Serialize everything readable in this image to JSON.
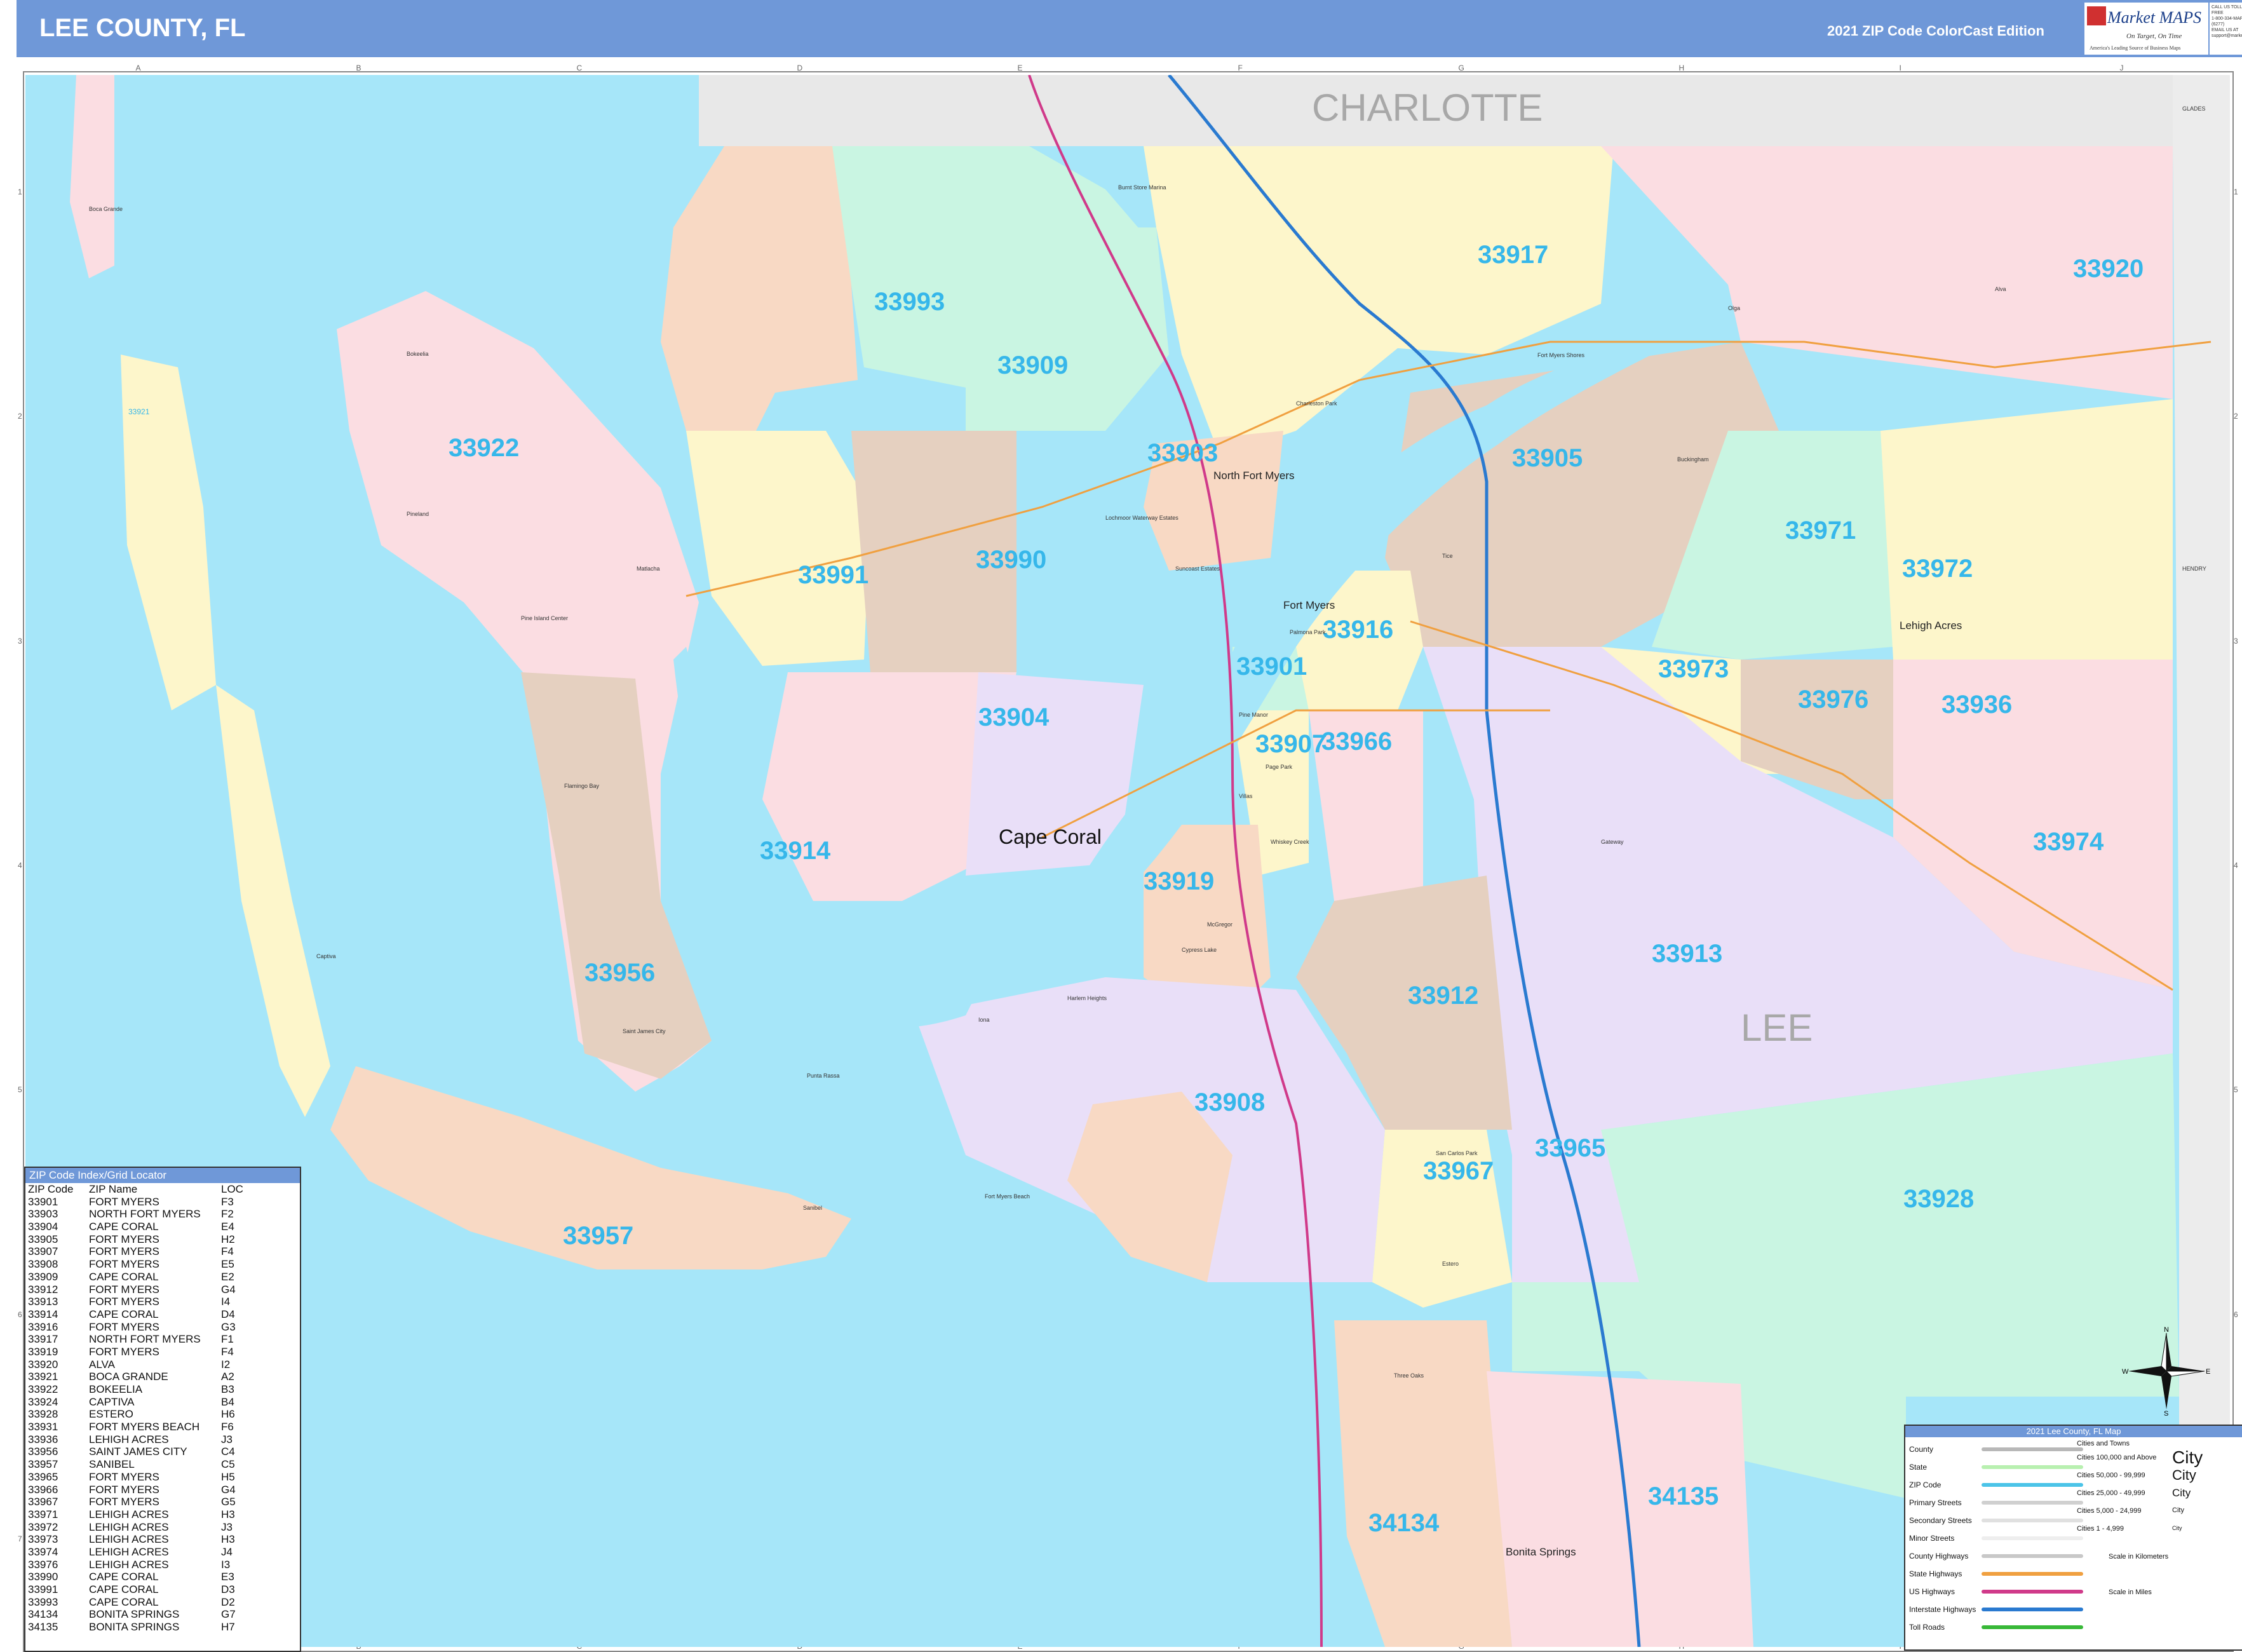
{
  "header": {
    "title": "LEE COUNTY, FL",
    "edition": "2021 ZIP Code ColorCast Edition",
    "logo_text": "Market MAPS",
    "logo_tagline": "On Target, On Time",
    "logo_subtitle": "America's Leading Source of Business Maps",
    "contact_lines": [
      "CALL US TOLL FREE",
      "1-800-334-MAPS (6277)",
      "EMAIL US AT",
      "support@marketmaps.com"
    ]
  },
  "grid": {
    "columns": [
      "A",
      "B",
      "C",
      "D",
      "E",
      "F",
      "G",
      "H",
      "I",
      "J"
    ],
    "rows": [
      "1",
      "2",
      "3",
      "4",
      "5",
      "6",
      "7"
    ]
  },
  "map": {
    "county_labels": [
      "CHARLOTTE",
      "LEE"
    ],
    "neighbor_labels": [
      "GLADES",
      "HENDRY"
    ],
    "zip_labels": [
      "33917",
      "33920",
      "33993",
      "33909",
      "33922",
      "33903",
      "33905",
      "33971",
      "33972",
      "33991",
      "33990",
      "33916",
      "33901",
      "33973",
      "33976",
      "33936",
      "33904",
      "33907",
      "33966",
      "33914",
      "33919",
      "33974",
      "33913",
      "33956",
      "33912",
      "33908",
      "33965",
      "33967",
      "33957",
      "33928",
      "34134",
      "34135",
      "33921"
    ],
    "cities_big": [
      "Cape Coral"
    ],
    "cities_med": [
      "North Fort Myers",
      "Fort Myers",
      "Lehigh Acres",
      "Bonita Springs"
    ],
    "cities_small": [
      "Boca Grande",
      "Bokeelia",
      "Pineland",
      "Matlacha",
      "Pine Island Center",
      "Flamingo Bay",
      "Captiva",
      "Saint James City",
      "Sanibel",
      "Punta Rassa",
      "Fort Myers Beach",
      "Estero",
      "Three Oaks",
      "San Carlos Park",
      "Gateway",
      "Buckingham",
      "Fort Myers Shores",
      "Olga",
      "Alva",
      "Tice",
      "Pine Manor",
      "Page Park",
      "Villas",
      "Whiskey Creek",
      "Cypress Lake",
      "Iona",
      "Harlem Heights",
      "McGregor",
      "Palmona Park",
      "Suncoast Estates",
      "Charleston Park",
      "Lochmoor Waterway Estates",
      "Burnt Store Marina"
    ]
  },
  "index_panel": {
    "title": "ZIP Code Index/Grid Locator",
    "headers": [
      "ZIP Code",
      "ZIP Name",
      "LOC"
    ],
    "rows": [
      [
        "33901",
        "FORT MYERS",
        "F3"
      ],
      [
        "33903",
        "NORTH FORT MYERS",
        "F2"
      ],
      [
        "33904",
        "CAPE CORAL",
        "E4"
      ],
      [
        "33905",
        "FORT MYERS",
        "H2"
      ],
      [
        "33907",
        "FORT MYERS",
        "F4"
      ],
      [
        "33908",
        "FORT MYERS",
        "E5"
      ],
      [
        "33909",
        "CAPE CORAL",
        "E2"
      ],
      [
        "33912",
        "FORT MYERS",
        "G4"
      ],
      [
        "33913",
        "FORT MYERS",
        "I4"
      ],
      [
        "33914",
        "CAPE CORAL",
        "D4"
      ],
      [
        "33916",
        "FORT MYERS",
        "G3"
      ],
      [
        "33917",
        "NORTH FORT MYERS",
        "F1"
      ],
      [
        "33919",
        "FORT MYERS",
        "F4"
      ],
      [
        "33920",
        "ALVA",
        "I2"
      ],
      [
        "33921",
        "BOCA GRANDE",
        "A2"
      ],
      [
        "33922",
        "BOKEELIA",
        "B3"
      ],
      [
        "33924",
        "CAPTIVA",
        "B4"
      ],
      [
        "33928",
        "ESTERO",
        "H6"
      ],
      [
        "33931",
        "FORT MYERS BEACH",
        "F6"
      ],
      [
        "33936",
        "LEHIGH ACRES",
        "J3"
      ],
      [
        "33956",
        "SAINT JAMES CITY",
        "C4"
      ],
      [
        "33957",
        "SANIBEL",
        "C5"
      ],
      [
        "33965",
        "FORT MYERS",
        "H5"
      ],
      [
        "33966",
        "FORT MYERS",
        "G4"
      ],
      [
        "33967",
        "FORT MYERS",
        "G5"
      ],
      [
        "33971",
        "LEHIGH ACRES",
        "H3"
      ],
      [
        "33972",
        "LEHIGH ACRES",
        "J3"
      ],
      [
        "33973",
        "LEHIGH ACRES",
        "H3"
      ],
      [
        "33974",
        "LEHIGH ACRES",
        "J4"
      ],
      [
        "33976",
        "LEHIGH ACRES",
        "I3"
      ],
      [
        "33990",
        "CAPE CORAL",
        "E3"
      ],
      [
        "33991",
        "CAPE CORAL",
        "D3"
      ],
      [
        "33993",
        "CAPE CORAL",
        "D2"
      ],
      [
        "34134",
        "BONITA SPRINGS",
        "G7"
      ],
      [
        "34135",
        "BONITA SPRINGS",
        "H7"
      ]
    ]
  },
  "legend": {
    "title": "2021 Lee County, FL Map",
    "line_items": [
      {
        "label": "County",
        "color": "#b8b8b8"
      },
      {
        "label": "State",
        "color": "#b8f0b0"
      },
      {
        "label": "ZIP Code",
        "color": "#4cc4e8"
      },
      {
        "label": "Primary Streets",
        "color": "#d0d0d0"
      },
      {
        "label": "Secondary Streets",
        "color": "#e0e0e0"
      },
      {
        "label": "Minor Streets",
        "color": "#eeeeee"
      },
      {
        "label": "County Highways",
        "color": "#c8c8c8"
      },
      {
        "label": "State Highways",
        "color": "#f0a040"
      },
      {
        "label": "US Highways",
        "color": "#d03a8a"
      },
      {
        "label": "Interstate Highways",
        "color": "#2a7ad0"
      },
      {
        "label": "Toll Roads",
        "color": "#38b838"
      }
    ],
    "cities_header": "Cities and Towns",
    "city_items": [
      {
        "label": "Cities 100,000 and Above",
        "sample": "City"
      },
      {
        "label": "Cities 50,000 - 99,999",
        "sample": "City"
      },
      {
        "label": "Cities 25,000 - 49,999",
        "sample": "City"
      },
      {
        "label": "Cities 5,000 - 24,999",
        "sample": "City"
      },
      {
        "label": "Cities 1 - 4,999",
        "sample": "City"
      }
    ],
    "scale_km": "Scale in Kilometers",
    "scale_mi": "Scale in Miles"
  },
  "compass": {
    "n": "N",
    "s": "S",
    "e": "E",
    "w": "W"
  },
  "colors": {
    "header": "#6f98d8",
    "water": "#a6e6f9",
    "zip_label": "#36b7ea",
    "pink": "#fbdde2",
    "peach": "#f8d9c4",
    "yellow": "#fdf6cb",
    "green": "#c9f5e2",
    "tan": "#e5d0c0",
    "lavender": "#e9dff8",
    "grey": "#e8e8e8"
  }
}
